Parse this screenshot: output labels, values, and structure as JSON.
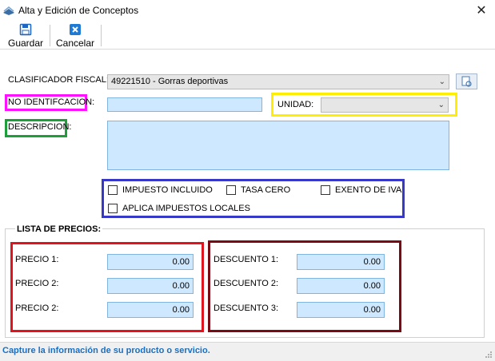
{
  "window": {
    "title": "Alta y Edición de Conceptos",
    "close_glyph": "✕"
  },
  "toolbar": {
    "save_label": "Guardar",
    "cancel_label": "Cancelar",
    "save_icon": "floppy-disk-icon",
    "cancel_icon": "cancel-x-icon"
  },
  "form": {
    "clasificador_label": "CLASIFICADOR FISCAL:",
    "clasificador_value": "49221510 - Gorras deportivas",
    "no_ident_label": "NO IDENTIFCACION:",
    "no_ident_value": "",
    "unidad_label": "UNIDAD:",
    "unidad_value": "",
    "descripcion_label": "DESCRIPCION:",
    "descripcion_value": ""
  },
  "options": {
    "impuesto_incluido": "IMPUESTO INCLUIDO",
    "tasa_cero": "TASA CERO",
    "exento_iva": "EXENTO DE IVA",
    "aplica_locales": "APLICA IMPUESTOS LOCALES"
  },
  "prices": {
    "group_title": "LISTA DE PRECIOS:",
    "precios": [
      {
        "label": "PRECIO 1:",
        "value": "0.00"
      },
      {
        "label": "PRECIO 2:",
        "value": "0.00"
      },
      {
        "label": "PRECIO 2:",
        "value": "0.00"
      }
    ],
    "descuentos": [
      {
        "label": "DESCUENTO 1:",
        "value": "0.00"
      },
      {
        "label": "DESCUENTO 2:",
        "value": "0.00"
      },
      {
        "label": "DESCUENTO 3:",
        "value": "0.00"
      }
    ]
  },
  "status": {
    "text": "Capture la información de su producto o servicio."
  },
  "colors": {
    "input_bg": "#cde8ff",
    "status_text": "#1a6fc0",
    "highlight_magenta": "#ff10ff",
    "highlight_green": "#1e9e3a",
    "highlight_yellow": "#ffee00",
    "highlight_blue": "#3838c8",
    "highlight_red": "#e0141e",
    "highlight_maroon": "#7a0a14"
  }
}
